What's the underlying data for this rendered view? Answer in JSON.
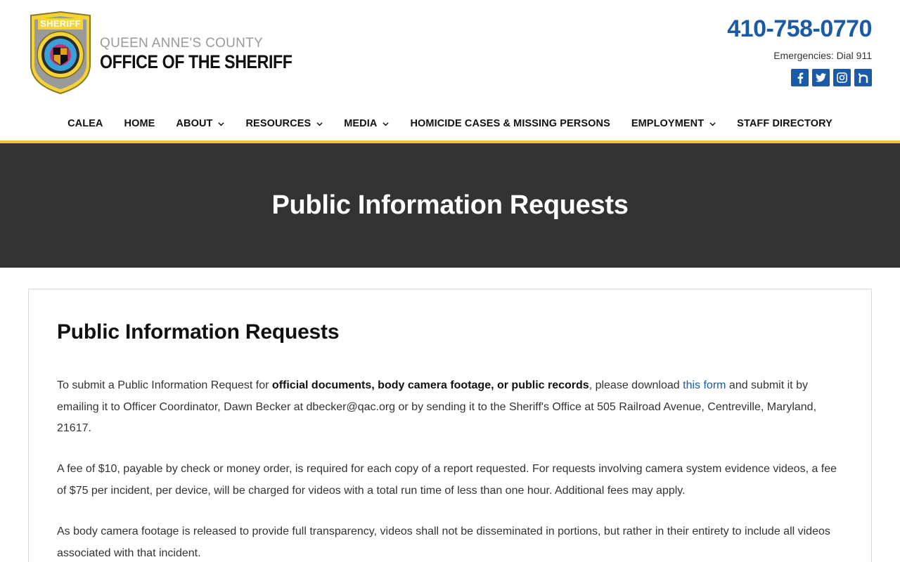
{
  "header": {
    "logo_badge_text": "SHERIFF",
    "org_top": "QUEEN ANNE'S COUNTY",
    "org_bottom": "OFFICE OF THE SHERIFF",
    "phone": "410-758-0770",
    "emergency": "Emergencies: Dial 911",
    "socials": [
      {
        "icon": "facebook-icon",
        "glyph": "f"
      },
      {
        "icon": "twitter-icon",
        "glyph": "t"
      },
      {
        "icon": "instagram-icon",
        "glyph": "o"
      },
      {
        "icon": "nextdoor-icon",
        "glyph": "n"
      }
    ]
  },
  "nav": {
    "items": [
      {
        "label": "CALEA",
        "dropdown": false
      },
      {
        "label": "HOME",
        "dropdown": false
      },
      {
        "label": "ABOUT",
        "dropdown": true
      },
      {
        "label": "RESOURCES",
        "dropdown": true
      },
      {
        "label": "MEDIA",
        "dropdown": true
      },
      {
        "label": "HOMICIDE CASES & MISSING PERSONS",
        "dropdown": false
      },
      {
        "label": "EMPLOYMENT",
        "dropdown": true
      },
      {
        "label": "STAFF DIRECTORY",
        "dropdown": false
      }
    ]
  },
  "hero": {
    "title": "Public Information Requests"
  },
  "content": {
    "heading": "Public Information Requests",
    "p1": {
      "before": "To submit a Public Information Request for ",
      "bold": "official documents, body camera footage, or public records",
      "middle": ", please download ",
      "link": "this form",
      "after": " and submit it by emailing it to Officer Coordinator, Dawn Becker at dbecker@qac.org or by sending it to the Sheriff's Office at 505 Railroad Avenue, Centreville, Maryland, 21617."
    },
    "p2": "A fee of $10, payable by check or money order, is required for each copy of a report requested. For requests involving camera system evidence videos, a fee of $75 per incident, per device, will be charged for videos with a total run time of less than one hour. Additional fees may apply.",
    "p3": "As body camera footage is released to provide full transparency, videos shall not be disseminated in portions, but rather in their entirety to include all videos associated with that incident."
  },
  "colors": {
    "accent_blue": "#1a5aa6",
    "gold": "#f0c330",
    "hero_bg": "#333333"
  }
}
